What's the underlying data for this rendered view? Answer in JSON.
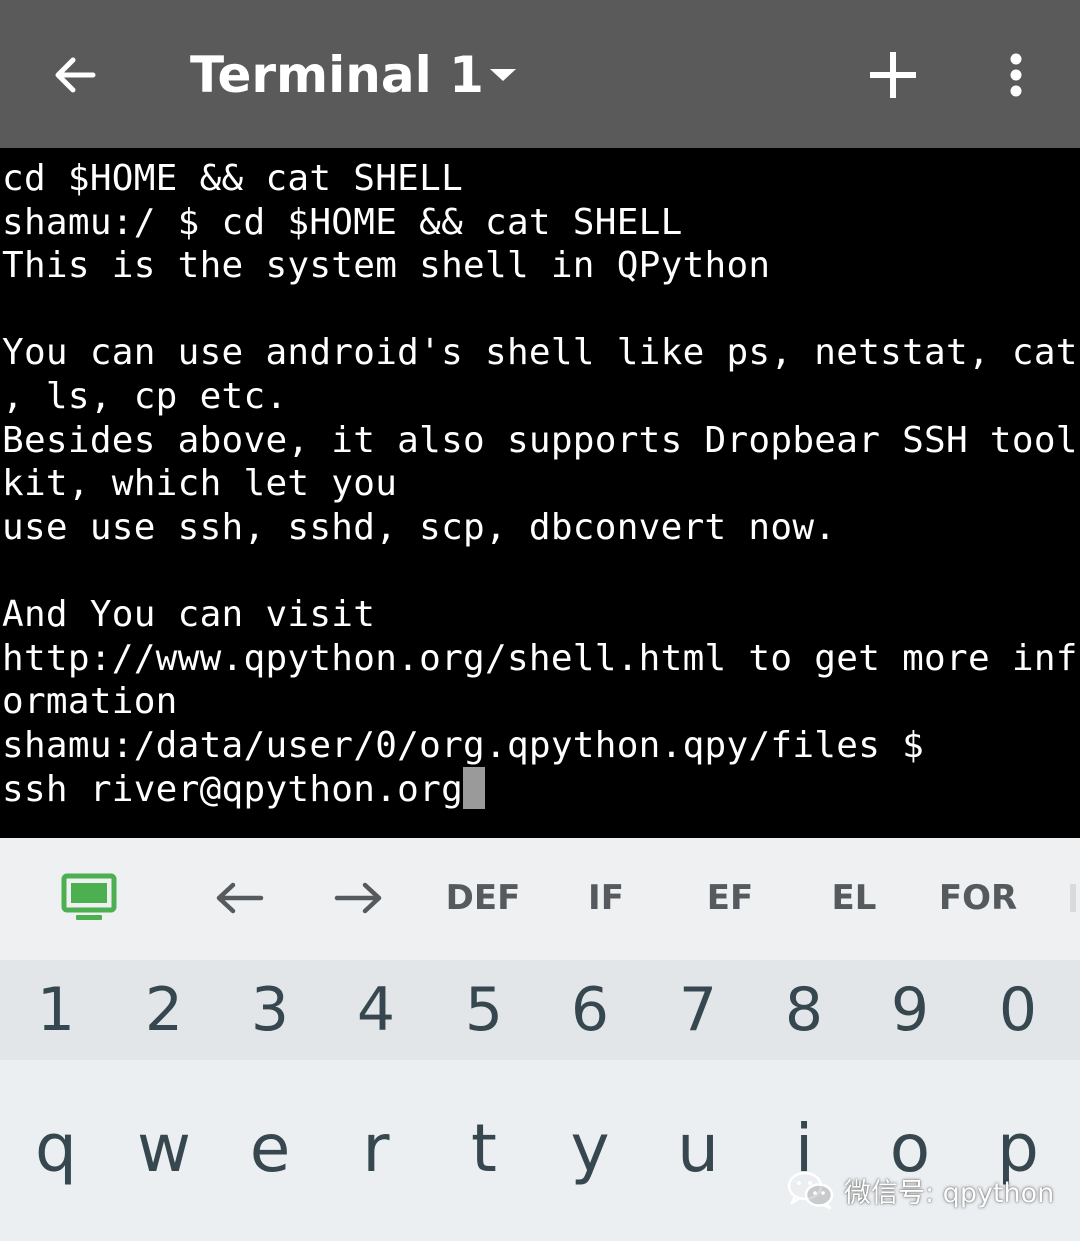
{
  "toolbar": {
    "title": "Terminal 1",
    "back_icon": "arrow-back-icon",
    "dropdown_icon": "caret-down-icon",
    "add_icon": "plus-icon",
    "more_icon": "more-vert-icon",
    "background": "#5a5a5a"
  },
  "terminal": {
    "background": "#000000",
    "foreground": "#ffffff",
    "lines": [
      "cd $HOME && cat SHELL",
      "shamu:/ $ cd $HOME && cat SHELL",
      "This is the system shell in QPython",
      "",
      "You can use android's shell like ps, netstat, cat",
      ", ls, cp etc.",
      "Besides above, it also supports Dropbear SSH tool",
      "kit, which let you",
      "use use ssh, sshd, scp, dbconvert now.",
      "",
      "And You can visit",
      "http://www.qpython.org/shell.html to get more inf",
      "ormation",
      "shamu:/data/user/0/org.qpython.qpy/files $",
      "ssh river@qpython.org"
    ]
  },
  "extra_keys": {
    "icon": "monitor-icon",
    "icon_color": "#4caf50",
    "left_arrow": "←",
    "right_arrow": "→",
    "keys": [
      "DEF",
      "IF",
      "EF",
      "EL",
      "FOR"
    ]
  },
  "keyboard": {
    "numbers": [
      "1",
      "2",
      "3",
      "4",
      "5",
      "6",
      "7",
      "8",
      "9",
      "0"
    ],
    "letters": [
      "q",
      "w",
      "e",
      "r",
      "t",
      "y",
      "u",
      "i",
      "o",
      "p"
    ]
  },
  "watermark": {
    "icon": "wechat-logo",
    "text": "微信号: qpython"
  }
}
